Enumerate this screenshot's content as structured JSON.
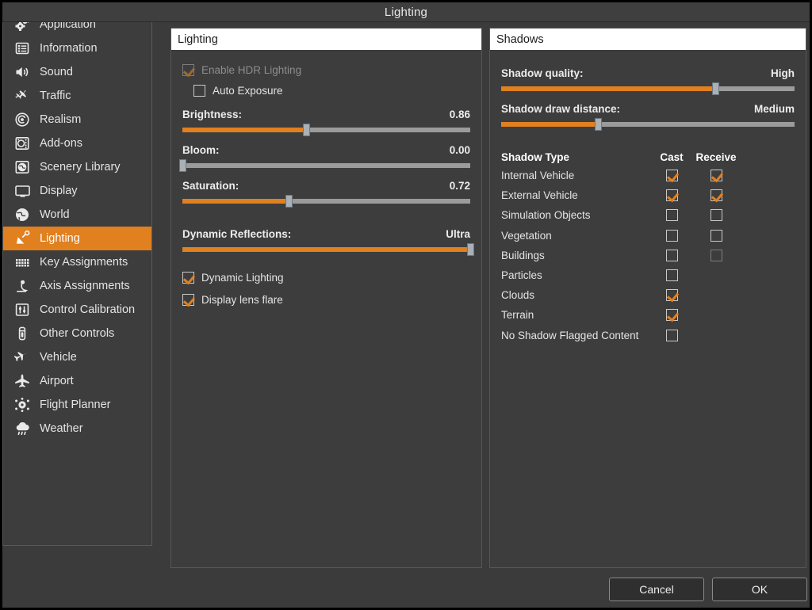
{
  "window": {
    "title": "Lighting"
  },
  "sidebar": {
    "items": [
      {
        "label": "Application",
        "icon": "gears-icon",
        "active": false
      },
      {
        "label": "Information",
        "icon": "list-icon",
        "active": false
      },
      {
        "label": "Sound",
        "icon": "speaker-icon",
        "active": false
      },
      {
        "label": "Traffic",
        "icon": "traffic-planes-icon",
        "active": false
      },
      {
        "label": "Realism",
        "icon": "spiral-icon",
        "active": false
      },
      {
        "label": "Add-ons",
        "icon": "addons-box-icon",
        "active": false
      },
      {
        "label": "Scenery Library",
        "icon": "globe-square-icon",
        "active": false
      },
      {
        "label": "Display",
        "icon": "monitor-icon",
        "active": false
      },
      {
        "label": "World",
        "icon": "globe-icon",
        "active": false
      },
      {
        "label": "Lighting",
        "icon": "lamp-icon",
        "active": true
      },
      {
        "label": "Key Assignments",
        "icon": "keyboard-icon",
        "active": false
      },
      {
        "label": "Axis Assignments",
        "icon": "joystick-icon",
        "active": false
      },
      {
        "label": "Control Calibration",
        "icon": "sliders-icon",
        "active": false
      },
      {
        "label": "Other Controls",
        "icon": "gamepad-icon",
        "active": false
      },
      {
        "label": "Vehicle",
        "icon": "plane-icon",
        "active": false
      },
      {
        "label": "Airport",
        "icon": "airport-plane-icon",
        "active": false
      },
      {
        "label": "Flight Planner",
        "icon": "route-icon",
        "active": false
      },
      {
        "label": "Weather",
        "icon": "cloud-rain-icon",
        "active": false
      }
    ]
  },
  "lighting": {
    "header": "Lighting",
    "hdr": {
      "label": "Enable HDR Lighting",
      "checked": true,
      "disabled": true
    },
    "auto_exposure": {
      "label": "Auto Exposure",
      "checked": false,
      "disabled": false
    },
    "sliders": [
      {
        "label": "Brightness:",
        "value": "0.86",
        "percent": 43
      },
      {
        "label": "Bloom:",
        "value": "0.00",
        "percent": 0
      },
      {
        "label": "Saturation:",
        "value": "0.72",
        "percent": 37
      },
      {
        "label": "Dynamic Reflections:",
        "value": "Ultra",
        "percent": 100
      }
    ],
    "dynamic_lighting": {
      "label": "Dynamic Lighting",
      "checked": true,
      "disabled": false
    },
    "lens_flare": {
      "label": "Display lens flare",
      "checked": true,
      "disabled": false
    }
  },
  "shadows": {
    "header": "Shadows",
    "sliders": [
      {
        "label": "Shadow quality:",
        "value": "High",
        "percent": 73
      },
      {
        "label": "Shadow draw distance:",
        "value": "Medium",
        "percent": 33
      }
    ],
    "columns": {
      "name": "Shadow Type",
      "cast": "Cast",
      "receive": "Receive"
    },
    "rows": [
      {
        "name": "Internal Vehicle",
        "cast": true,
        "receive": true,
        "has_receive": true,
        "receive_disabled": false
      },
      {
        "name": "External Vehicle",
        "cast": true,
        "receive": true,
        "has_receive": true,
        "receive_disabled": false
      },
      {
        "name": "Simulation Objects",
        "cast": false,
        "receive": false,
        "has_receive": true,
        "receive_disabled": false
      },
      {
        "name": "Vegetation",
        "cast": false,
        "receive": false,
        "has_receive": true,
        "receive_disabled": false
      },
      {
        "name": "Buildings",
        "cast": false,
        "receive": false,
        "has_receive": true,
        "receive_disabled": true
      },
      {
        "name": "Particles",
        "cast": false,
        "receive": false,
        "has_receive": false,
        "receive_disabled": false
      },
      {
        "name": "Clouds",
        "cast": true,
        "receive": false,
        "has_receive": false,
        "receive_disabled": false
      },
      {
        "name": "Terrain",
        "cast": true,
        "receive": false,
        "has_receive": false,
        "receive_disabled": false
      },
      {
        "name": "No Shadow Flagged Content",
        "cast": false,
        "receive": false,
        "has_receive": false,
        "receive_disabled": false
      }
    ]
  },
  "footer": {
    "cancel": "Cancel",
    "ok": "OK"
  },
  "colors": {
    "accent": "#e0801f",
    "panel": "#3d3d3d",
    "text": "#e4e4e4"
  }
}
